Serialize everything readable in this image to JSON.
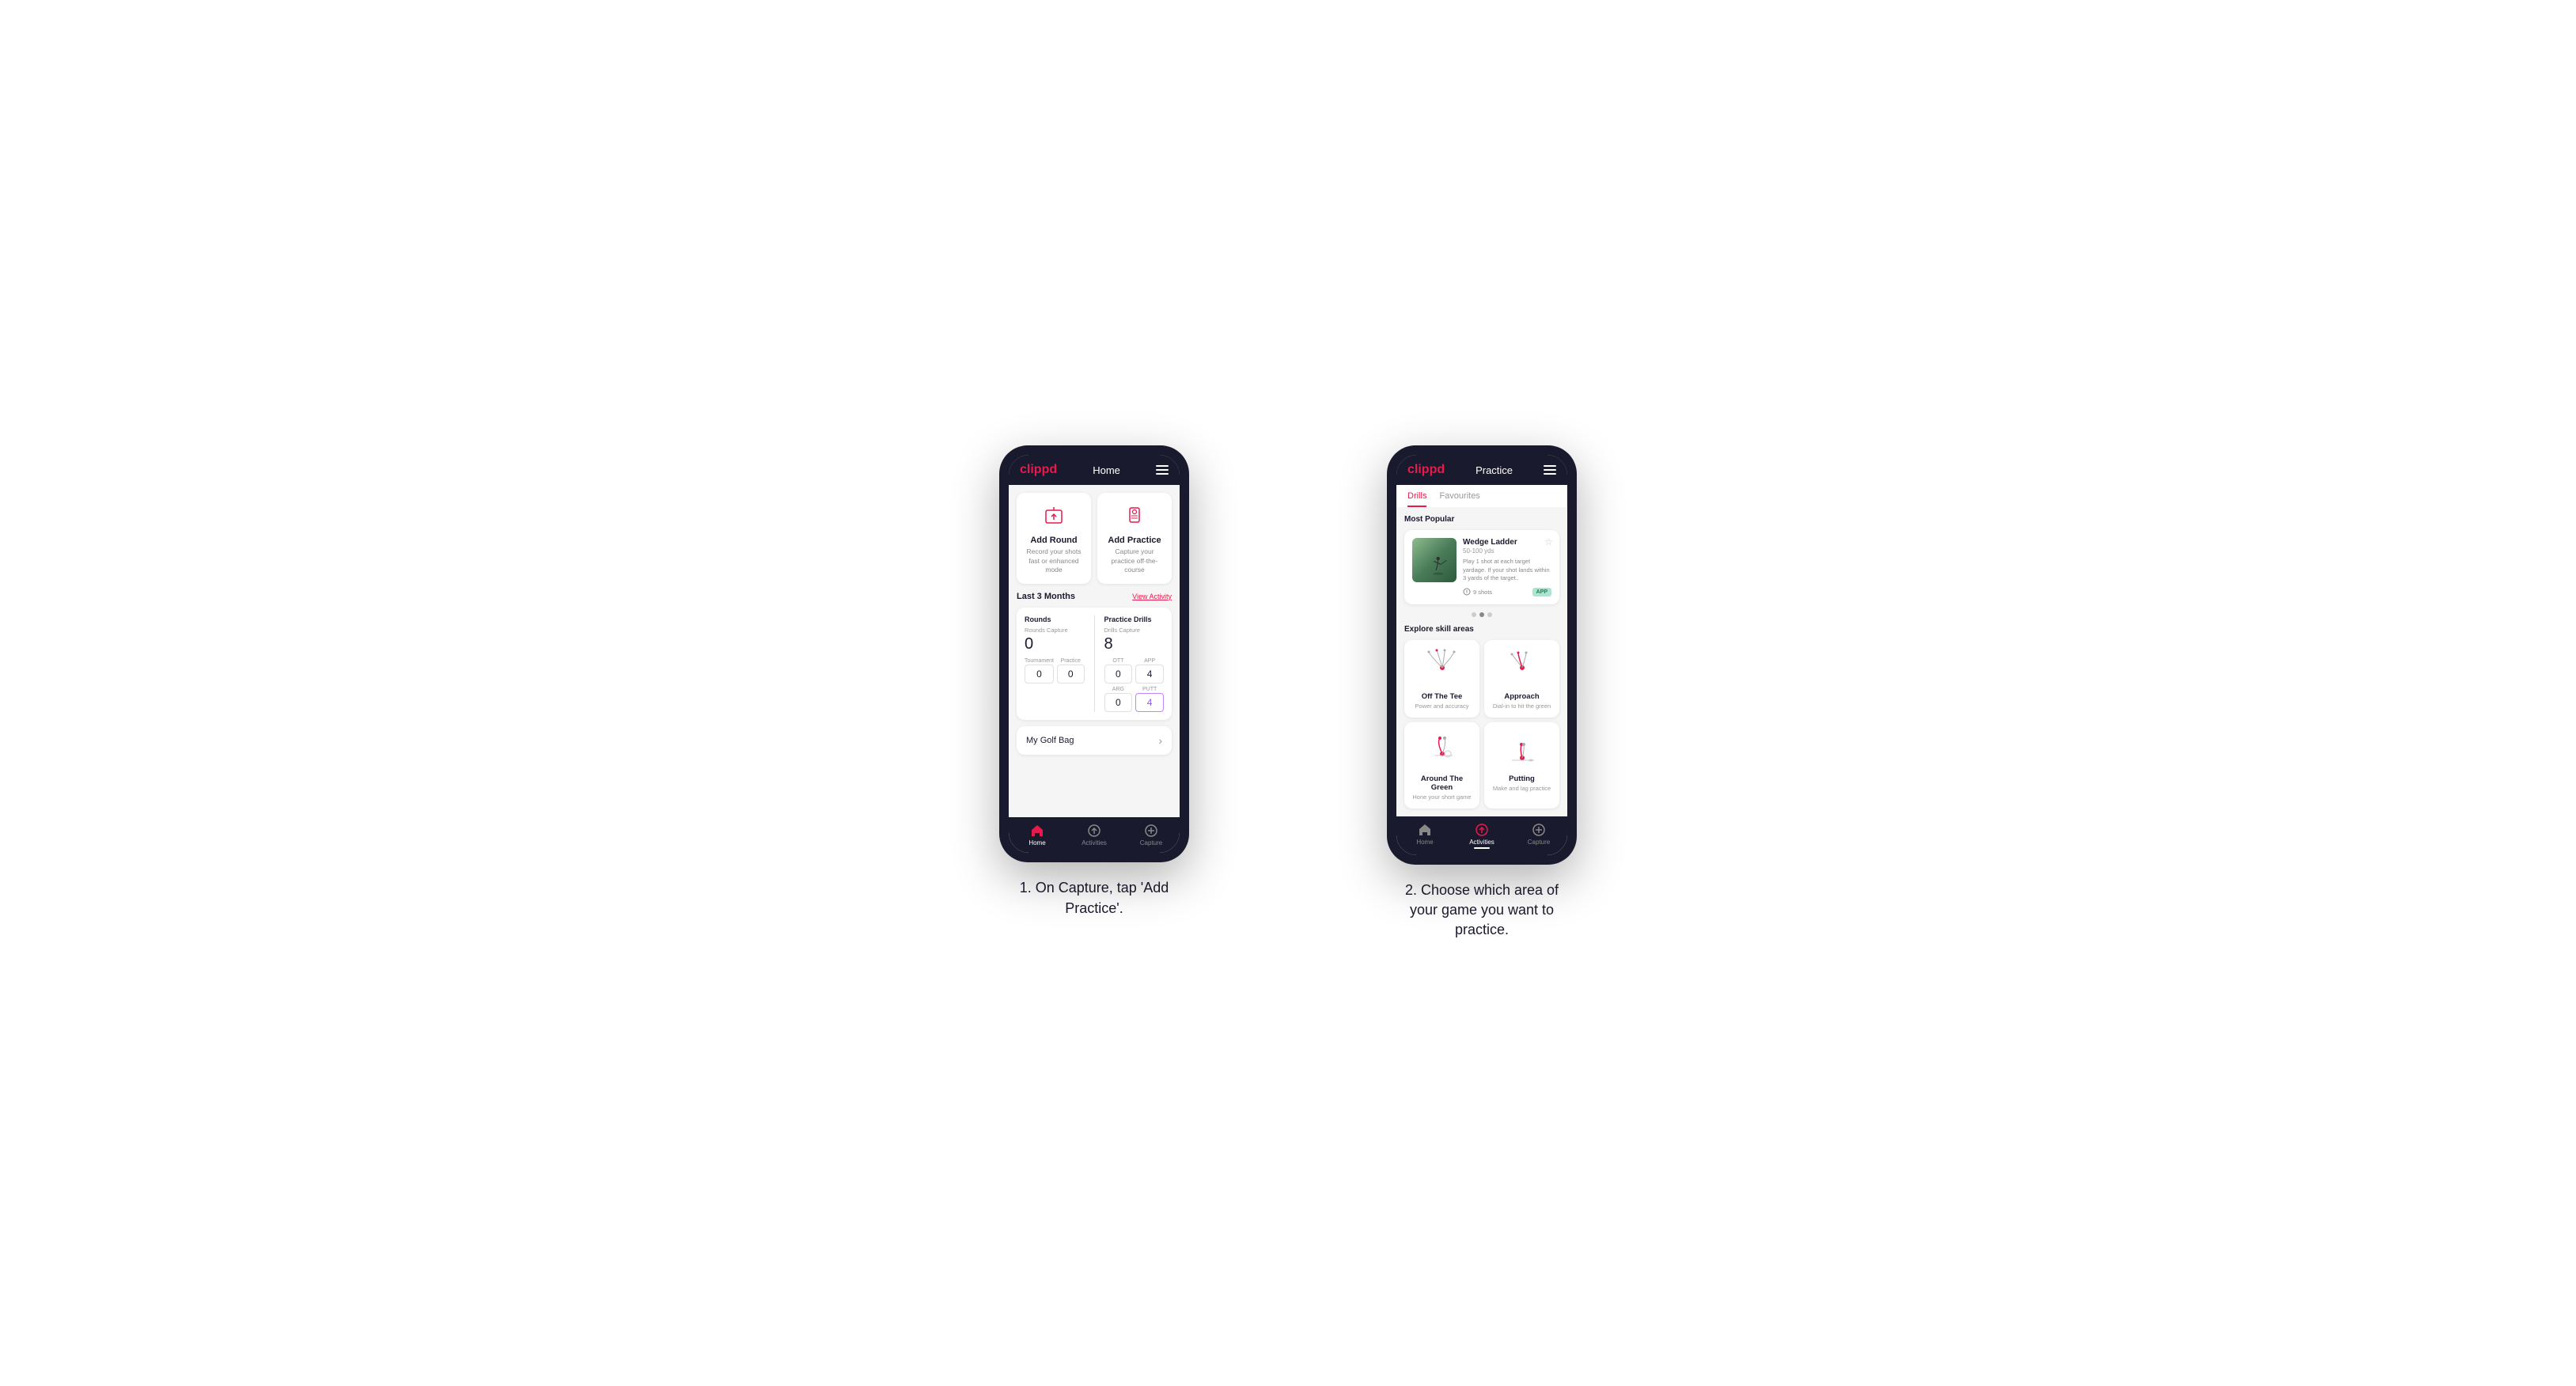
{
  "phone1": {
    "header": {
      "logo": "clippd",
      "title": "Home",
      "menu_icon": "menu"
    },
    "action_cards": [
      {
        "title": "Add Round",
        "subtitle": "Record your shots fast or enhanced mode",
        "icon": "flag"
      },
      {
        "title": "Add Practice",
        "subtitle": "Capture your practice off-the-course",
        "icon": "bookmark"
      }
    ],
    "last3months": {
      "label": "Last 3 Months",
      "link": "View Activity"
    },
    "rounds": {
      "title": "Rounds",
      "capture_label": "Rounds Capture",
      "capture_value": "0",
      "tournament_label": "Tournament",
      "tournament_value": "0",
      "practice_label": "Practice",
      "practice_value": "0"
    },
    "drills": {
      "title": "Practice Drills",
      "capture_label": "Drills Capture",
      "capture_value": "8",
      "ott_label": "OTT",
      "ott_value": "0",
      "app_label": "APP",
      "app_value": "4",
      "arg_label": "ARG",
      "arg_value": "0",
      "putt_label": "PUTT",
      "putt_value": "4"
    },
    "my_bag": {
      "label": "My Golf Bag"
    },
    "bottom_nav": [
      {
        "label": "Home",
        "icon": "home",
        "active": true
      },
      {
        "label": "Activities",
        "icon": "activities",
        "active": false
      },
      {
        "label": "Capture",
        "icon": "plus-circle",
        "active": false
      }
    ]
  },
  "phone2": {
    "header": {
      "logo": "clippd",
      "title": "Practice",
      "menu_icon": "menu"
    },
    "tabs": [
      {
        "label": "Drills",
        "active": true
      },
      {
        "label": "Favourites",
        "active": false
      }
    ],
    "most_popular": {
      "label": "Most Popular",
      "featured_drill": {
        "title": "Wedge Ladder",
        "distance": "50-100 yds",
        "description": "Play 1 shot at each target yardage. If your shot lands within 3 yards of the target..",
        "shots": "9 shots",
        "badge": "APP"
      }
    },
    "explore": {
      "label": "Explore skill areas",
      "skills": [
        {
          "title": "Off The Tee",
          "subtitle": "Power and accuracy",
          "icon": "tee-shot"
        },
        {
          "title": "Approach",
          "subtitle": "Dial-in to hit the green",
          "icon": "approach-shot"
        },
        {
          "title": "Around The Green",
          "subtitle": "Hone your short game",
          "icon": "around-green"
        },
        {
          "title": "Putting",
          "subtitle": "Make and lag practice",
          "icon": "putting"
        }
      ]
    },
    "bottom_nav": [
      {
        "label": "Home",
        "icon": "home",
        "active": false
      },
      {
        "label": "Activities",
        "icon": "activities",
        "active": true
      },
      {
        "label": "Capture",
        "icon": "plus-circle",
        "active": false
      }
    ]
  },
  "instructions": [
    {
      "text": "1. On Capture, tap 'Add Practice'."
    },
    {
      "text": "2. Choose which area of your game you want to practice."
    }
  ],
  "colors": {
    "brand_pink": "#e8194b",
    "dark_navy": "#1a1a2e",
    "light_gray": "#f5f5f5",
    "white": "#ffffff",
    "text_gray": "#888888",
    "purple": "#8b5cf6",
    "green_badge": "#a8e6cf"
  }
}
